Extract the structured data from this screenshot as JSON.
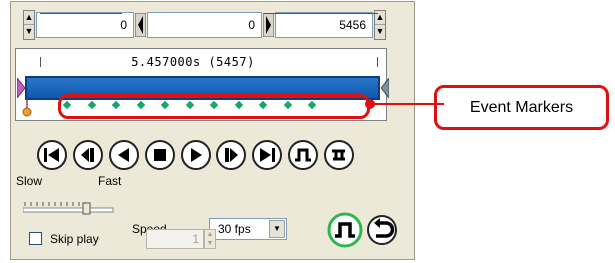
{
  "range": {
    "start_value": "0",
    "current_value": "0",
    "end_value": "5456",
    "duration_text": "5.457000s (5457)"
  },
  "event_markers": {
    "count": 11,
    "color": "#18a66a"
  },
  "transport": {
    "buttons": [
      "go-to-start",
      "step-back",
      "play-reverse",
      "stop",
      "play",
      "step-forward",
      "go-to-end",
      "loop",
      "ping-pong"
    ]
  },
  "speed": {
    "slow_label": "Slow",
    "fast_label": "Fast",
    "speed_label": "Speed",
    "fps_value": "30 fps"
  },
  "skip": {
    "label": "Skip play",
    "value": "1"
  },
  "callout": {
    "label": "Event Markers",
    "color": "#e01010"
  },
  "colors": {
    "track": "#1565c0",
    "panel_bg": "#ece9d8",
    "active_ring": "#2db84b"
  }
}
